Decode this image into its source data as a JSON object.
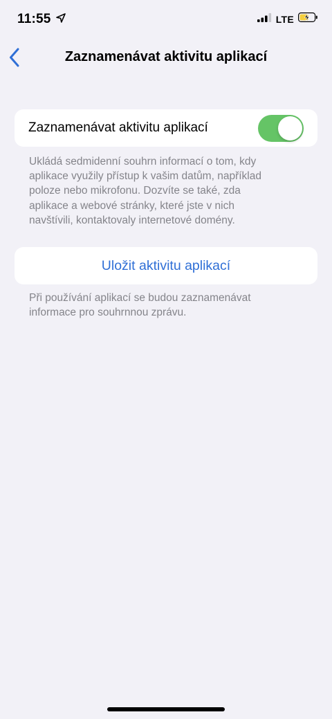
{
  "status_bar": {
    "time": "11:55",
    "network": "LTE",
    "icons": [
      "location-arrow-icon",
      "signal-bars-icon",
      "battery-charging-icon"
    ]
  },
  "nav": {
    "title": "Zaznamenávat aktivitu aplikací",
    "back_icon": "chevron-left-icon"
  },
  "settings": {
    "toggle_label": "Zaznamenávat aktivitu aplikací",
    "toggle_on": true,
    "toggle_footer_lines": [
      "Ukládá sedmidenní souhrn informací o tom, kdy",
      "aplikace využily přístup k vašim datům, například",
      "poloze nebo mikrofonu. Dozvíte se také, zda",
      "aplikace a webové stránky, které jste v nich",
      "navštívili, kontaktovaly internetové domény."
    ],
    "save_button_label": "Uložit aktivitu aplikací",
    "save_footer_lines": [
      "Při používání aplikací se budou zaznamenávat",
      "informace pro souhrnnou zprávu."
    ]
  },
  "colors": {
    "background": "#f2f1f7",
    "accent": "#2f6fd6",
    "switch_on": "#65c466",
    "footer_text": "#84848a",
    "battery_fill": "#f4cf3e"
  }
}
